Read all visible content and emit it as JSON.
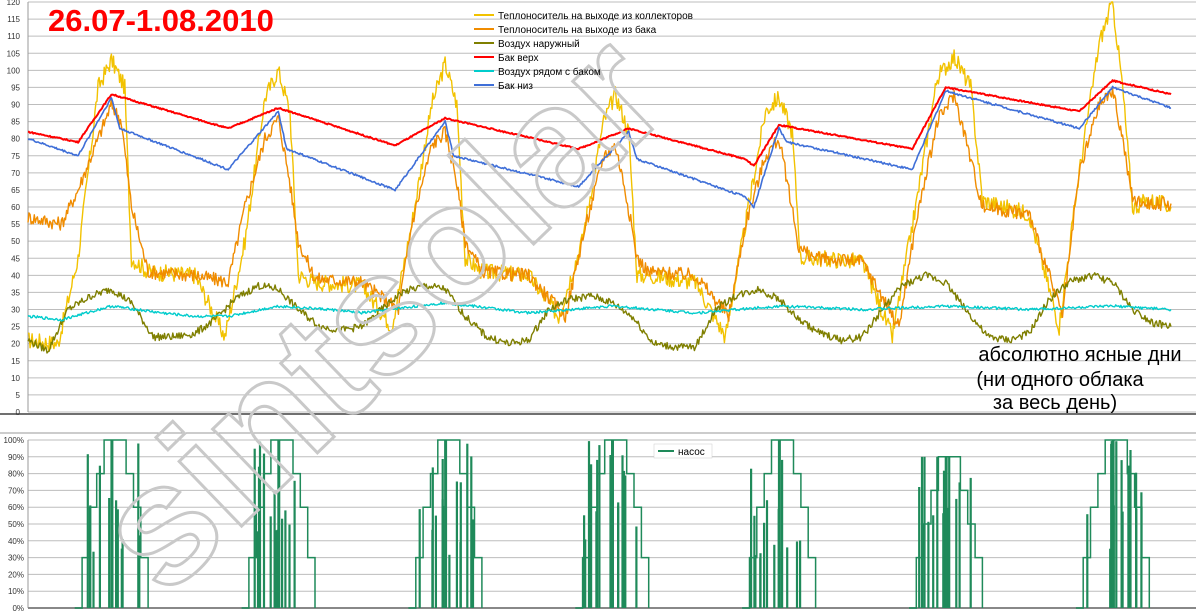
{
  "title": "26.07-1.08.2010",
  "watermark": "sintsolar",
  "annotation": [
    "абсолютно ясные дни",
    "(ни одного облака",
    "за весь день)"
  ],
  "chart_data": [
    {
      "type": "line",
      "ylim": [
        0,
        120
      ],
      "y_ticks": [
        "0",
        "5",
        "10",
        "15",
        "20",
        "25",
        "30",
        "35",
        "40",
        "45",
        "50",
        "55",
        "60",
        "65",
        "70",
        "75",
        "80",
        "85",
        "90",
        "95",
        "100",
        "105",
        "110",
        "115",
        "120"
      ],
      "grid": true,
      "legend_position": "top-center",
      "days": 7,
      "series": [
        {
          "name": "Теплоноситель на выходе из коллекторов",
          "color": "#f2c200",
          "nodes": [
            [
              0,
              21
            ],
            [
              0.18,
              20
            ],
            [
              0.3,
              45
            ],
            [
              0.42,
              95
            ],
            [
              0.5,
              103
            ],
            [
              0.58,
              95
            ],
            [
              0.62,
              45
            ],
            [
              0.72,
              41
            ],
            [
              1.0,
              40
            ],
            [
              1.18,
              22
            ],
            [
              1.3,
              50
            ],
            [
              1.42,
              92
            ],
            [
              1.5,
              100
            ],
            [
              1.57,
              88
            ],
            [
              1.62,
              40
            ],
            [
              1.72,
              38
            ],
            [
              2.0,
              37
            ],
            [
              2.18,
              25
            ],
            [
              2.3,
              55
            ],
            [
              2.42,
              90
            ],
            [
              2.5,
              102
            ],
            [
              2.57,
              90
            ],
            [
              2.62,
              45
            ],
            [
              2.72,
              41
            ],
            [
              3.0,
              40
            ],
            [
              3.18,
              28
            ],
            [
              3.32,
              50
            ],
            [
              3.45,
              85
            ],
            [
              3.52,
              93
            ],
            [
              3.6,
              82
            ],
            [
              3.65,
              40
            ],
            [
              3.72,
              40
            ],
            [
              4.0,
              38
            ],
            [
              4.18,
              22
            ],
            [
              4.3,
              55
            ],
            [
              4.42,
              88
            ],
            [
              4.5,
              92
            ],
            [
              4.58,
              82
            ],
            [
              4.63,
              45
            ],
            [
              4.72,
              45
            ],
            [
              5.0,
              44
            ],
            [
              5.18,
              22
            ],
            [
              5.32,
              60
            ],
            [
              5.45,
              98
            ],
            [
              5.55,
              104
            ],
            [
              5.65,
              95
            ],
            [
              5.72,
              62
            ],
            [
              5.85,
              60
            ],
            [
              6.0,
              58
            ],
            [
              6.18,
              25
            ],
            [
              6.3,
              70
            ],
            [
              6.42,
              108
            ],
            [
              6.5,
              120
            ],
            [
              6.56,
              95
            ],
            [
              6.62,
              60
            ],
            [
              6.72,
              62
            ],
            [
              6.85,
              60
            ]
          ]
        },
        {
          "name": "Теплоноситель на выходе из бака",
          "color": "#f08c00",
          "nodes": [
            [
              0,
              57
            ],
            [
              0.1,
              56
            ],
            [
              0.2,
              55
            ],
            [
              0.3,
              65
            ],
            [
              0.42,
              80
            ],
            [
              0.5,
              90
            ],
            [
              0.56,
              85
            ],
            [
              0.62,
              60
            ],
            [
              0.72,
              41
            ],
            [
              1.0,
              40
            ],
            [
              1.2,
              38
            ],
            [
              1.3,
              60
            ],
            [
              1.42,
              80
            ],
            [
              1.5,
              86
            ],
            [
              1.56,
              70
            ],
            [
              1.62,
              50
            ],
            [
              1.72,
              39
            ],
            [
              2.0,
              38
            ],
            [
              2.22,
              30
            ],
            [
              2.3,
              55
            ],
            [
              2.42,
              78
            ],
            [
              2.5,
              82
            ],
            [
              2.56,
              70
            ],
            [
              2.62,
              50
            ],
            [
              2.72,
              41
            ],
            [
              3.0,
              40
            ],
            [
              3.22,
              28
            ],
            [
              3.32,
              50
            ],
            [
              3.45,
              75
            ],
            [
              3.52,
              78
            ],
            [
              3.58,
              65
            ],
            [
              3.65,
              45
            ],
            [
              3.72,
              41
            ],
            [
              4.0,
              40
            ],
            [
              4.2,
              28
            ],
            [
              4.3,
              55
            ],
            [
              4.42,
              75
            ],
            [
              4.5,
              80
            ],
            [
              4.56,
              65
            ],
            [
              4.62,
              48
            ],
            [
              4.72,
              45
            ],
            [
              5.0,
              44
            ],
            [
              5.22,
              25
            ],
            [
              5.32,
              55
            ],
            [
              5.45,
              85
            ],
            [
              5.55,
              93
            ],
            [
              5.62,
              80
            ],
            [
              5.72,
              60
            ],
            [
              5.85,
              59
            ],
            [
              6.0,
              58
            ],
            [
              6.2,
              28
            ],
            [
              6.3,
              70
            ],
            [
              6.42,
              90
            ],
            [
              6.5,
              94
            ],
            [
              6.56,
              80
            ],
            [
              6.62,
              62
            ],
            [
              6.72,
              61
            ],
            [
              6.85,
              61
            ]
          ]
        },
        {
          "name": "Воздух наружный",
          "color": "#7f7f00",
          "nodes": [
            [
              0,
              21
            ],
            [
              0.12,
              18
            ],
            [
              0.24,
              30
            ],
            [
              0.38,
              34
            ],
            [
              0.5,
              36
            ],
            [
              0.62,
              32
            ],
            [
              0.75,
              22
            ],
            [
              0.88,
              22
            ],
            [
              1.0,
              23
            ],
            [
              1.12,
              27
            ],
            [
              1.24,
              33
            ],
            [
              1.38,
              37
            ],
            [
              1.5,
              36
            ],
            [
              1.62,
              30
            ],
            [
              1.75,
              25
            ],
            [
              1.88,
              24
            ],
            [
              2.0,
              25
            ],
            [
              2.12,
              30
            ],
            [
              2.24,
              35
            ],
            [
              2.38,
              37
            ],
            [
              2.5,
              36
            ],
            [
              2.62,
              28
            ],
            [
              2.75,
              22
            ],
            [
              2.88,
              20
            ],
            [
              3.0,
              21
            ],
            [
              3.12,
              30
            ],
            [
              3.24,
              33
            ],
            [
              3.38,
              34
            ],
            [
              3.5,
              32
            ],
            [
              3.62,
              28
            ],
            [
              3.75,
              20
            ],
            [
              3.88,
              19
            ],
            [
              4.0,
              19
            ],
            [
              4.12,
              30
            ],
            [
              4.24,
              34
            ],
            [
              4.38,
              36
            ],
            [
              4.5,
              33
            ],
            [
              4.62,
              27
            ],
            [
              4.75,
              23
            ],
            [
              4.88,
              21
            ],
            [
              5.0,
              22
            ],
            [
              5.12,
              30
            ],
            [
              5.24,
              37
            ],
            [
              5.38,
              40
            ],
            [
              5.5,
              38
            ],
            [
              5.62,
              30
            ],
            [
              5.75,
              22
            ],
            [
              5.88,
              21
            ],
            [
              6.0,
              23
            ],
            [
              6.12,
              33
            ],
            [
              6.24,
              38
            ],
            [
              6.38,
              40
            ],
            [
              6.5,
              38
            ],
            [
              6.62,
              30
            ],
            [
              6.75,
              26
            ],
            [
              6.85,
              25
            ]
          ]
        },
        {
          "name": "Бак верх",
          "color": "#ff0000",
          "nodes": [
            [
              0,
              82
            ],
            [
              0.3,
              79
            ],
            [
              0.5,
              93
            ],
            [
              1.2,
              83
            ],
            [
              1.5,
              89
            ],
            [
              2.2,
              78
            ],
            [
              2.5,
              86
            ],
            [
              3.3,
              77
            ],
            [
              3.6,
              83
            ],
            [
              4.3,
              74
            ],
            [
              4.35,
              72
            ],
            [
              4.5,
              84
            ],
            [
              5.3,
              77
            ],
            [
              5.5,
              95
            ],
            [
              6.3,
              88
            ],
            [
              6.5,
              97
            ],
            [
              6.85,
              93
            ]
          ]
        },
        {
          "name": "Воздух рядом с баком",
          "color": "#00cccc",
          "nodes": [
            [
              0,
              28
            ],
            [
              0.2,
              27
            ],
            [
              0.5,
              31
            ],
            [
              0.8,
              29
            ],
            [
              1.0,
              28
            ],
            [
              1.2,
              28
            ],
            [
              1.5,
              31
            ],
            [
              1.8,
              30
            ],
            [
              2.0,
              29
            ],
            [
              2.5,
              32
            ],
            [
              3.0,
              29
            ],
            [
              3.5,
              31
            ],
            [
              4.0,
              29
            ],
            [
              4.5,
              31
            ],
            [
              5.0,
              30
            ],
            [
              5.5,
              31
            ],
            [
              6.0,
              30
            ],
            [
              6.5,
              31
            ],
            [
              6.85,
              30
            ]
          ]
        },
        {
          "name": "Бак низ",
          "color": "#3f6fd8",
          "nodes": [
            [
              0,
              80
            ],
            [
              0.3,
              75
            ],
            [
              0.5,
              92
            ],
            [
              0.55,
              83
            ],
            [
              1.2,
              71
            ],
            [
              1.5,
              88
            ],
            [
              1.55,
              77
            ],
            [
              2.2,
              65
            ],
            [
              2.5,
              85
            ],
            [
              2.55,
              75
            ],
            [
              3.3,
              66
            ],
            [
              3.6,
              82
            ],
            [
              3.65,
              74
            ],
            [
              4.3,
              63
            ],
            [
              4.35,
              60
            ],
            [
              4.5,
              83
            ],
            [
              4.55,
              79
            ],
            [
              5.3,
              71
            ],
            [
              5.5,
              94
            ],
            [
              6.3,
              83
            ],
            [
              6.5,
              95
            ],
            [
              6.85,
              89
            ]
          ]
        }
      ]
    },
    {
      "type": "area",
      "ylim": [
        0,
        100
      ],
      "y_ticks": [
        "0%",
        "10%",
        "20%",
        "30%",
        "40%",
        "50%",
        "60%",
        "70%",
        "80%",
        "90%",
        "100%"
      ],
      "grid": true,
      "legend_position": "top-center",
      "series": [
        {
          "name": "насос",
          "color": "#1f8a5a",
          "daily_peak_percent": [
            100,
            100,
            100,
            100,
            100,
            90,
            100
          ]
        }
      ]
    }
  ]
}
